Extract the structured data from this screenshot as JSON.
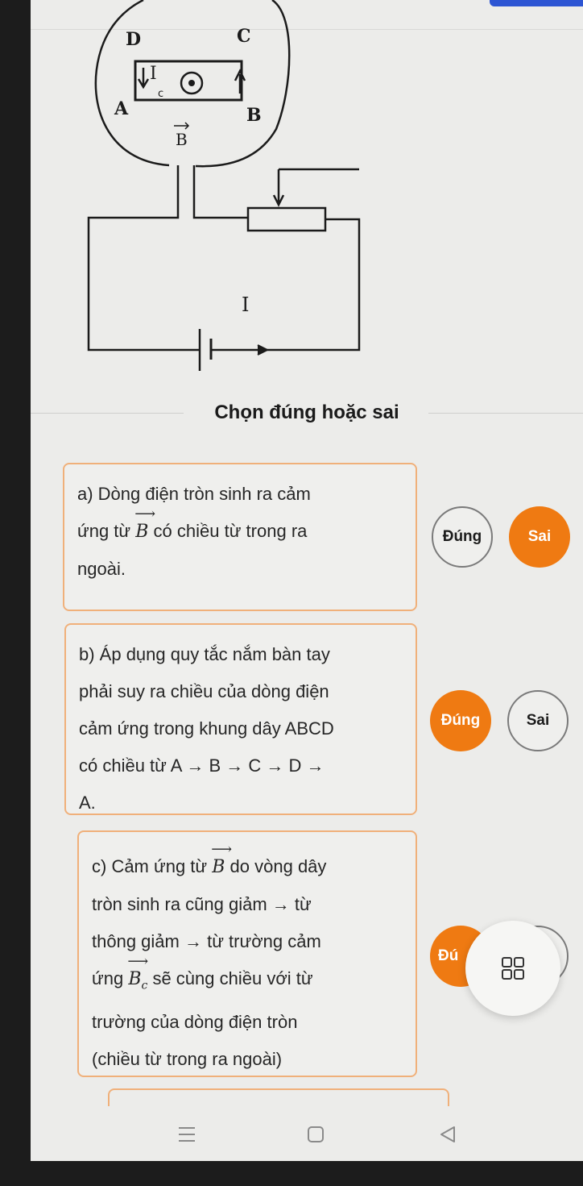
{
  "figure": {
    "label_D": "D",
    "label_C": "C",
    "label_A": "A",
    "label_B": "B",
    "label_Ic": "I",
    "label_Ic_sub": "c",
    "label_Bvec": "B",
    "label_I": "I"
  },
  "section_title": "Chọn đúng hoặc sai",
  "statements": [
    {
      "id": "a",
      "line1": "a) Dòng điện tròn sinh ra cảm",
      "line2_pre": "ứng từ ",
      "line2_vec": "B",
      "line2_post": " có chiều từ trong ra",
      "line3": "ngoài.",
      "true_label": "Đúng",
      "false_label": "Sai",
      "selected": "Sai"
    },
    {
      "id": "b",
      "line1": "b) Áp dụng quy tắc nắm bàn tay",
      "line2": "phải suy ra chiều của dòng điện",
      "line3": "cảm ứng trong khung dây ABCD",
      "line4": "có chiều từ A → B → C → D →",
      "line5": "A.",
      "true_label": "Đúng",
      "false_label": "Sai",
      "selected": "Đúng"
    },
    {
      "id": "c",
      "line1_pre": "c) Cảm ứng từ ",
      "line1_vec": "B",
      "line1_post": " do vòng dây",
      "line2": "tròn sinh ra cũng giảm → từ",
      "line3": "thông giảm → từ trường cảm",
      "line4_pre": "ứng ",
      "line4_vec": "B",
      "line4_sub": "c",
      "line4_post": " sẽ cùng chiều với từ",
      "line5": "trường của dòng điện tròn",
      "line6": "(chiều từ trong ra ngoài)",
      "true_label_partial": "Đú"
    }
  ],
  "fab": {
    "icon": "grid-icon"
  },
  "navbar": {
    "icons": [
      "menu-icon",
      "home-square-icon",
      "back-triangle-icon"
    ]
  },
  "colors": {
    "accent": "#ef7a12",
    "card_border": "#f0b07a",
    "top_accent": "#2d55d3"
  }
}
